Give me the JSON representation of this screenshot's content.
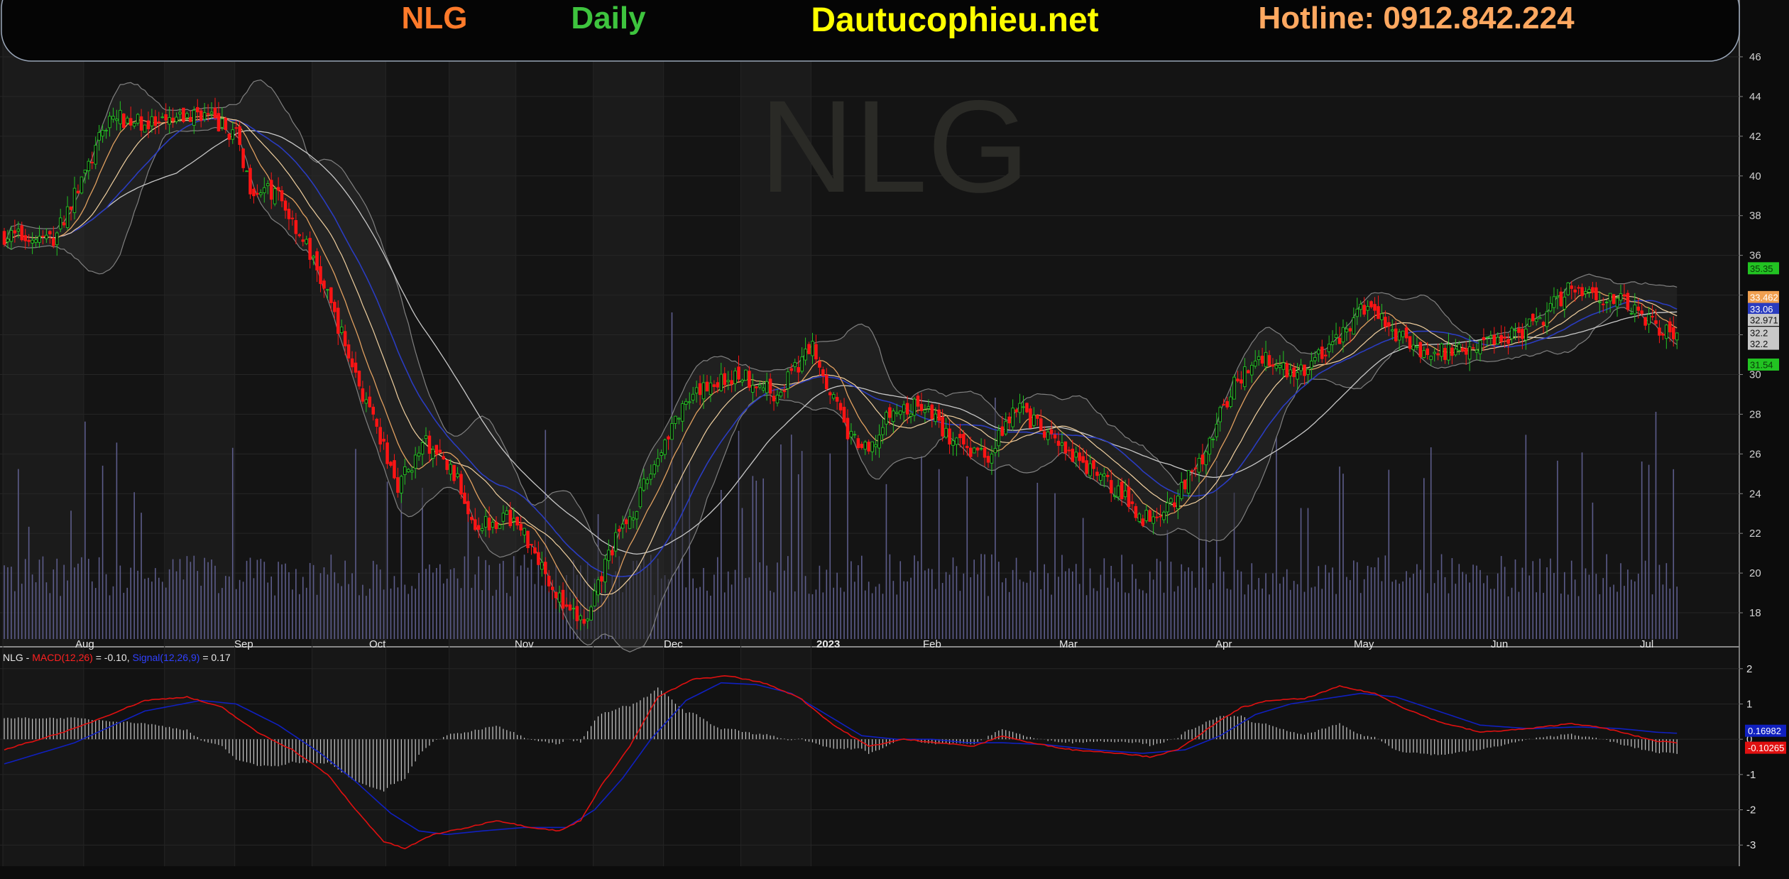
{
  "header": {
    "symbol": "NLG",
    "period": "Daily",
    "site": "Dautucophieu.net",
    "hotline": "Hotline: 0912.842.224"
  },
  "watermark": "NLG",
  "colors": {
    "background": "#151515",
    "up": "#22c322",
    "down": "#ff1414",
    "volume": "#5c5c8a",
    "sma_fast": "#e0a060",
    "sma_mid": "#f0d0a0",
    "sma_blue": "#2a3cc0",
    "sma_slow": "#c8c8c8",
    "band": "#808080",
    "macd": "#e01010",
    "signal": "#1020c0",
    "symbol_text": "#ff7a2a",
    "period_text": "#3ec43e",
    "site_text": "#ffff00",
    "hotline_text": "#ffa860"
  },
  "chart_data": [
    {
      "type": "candlestick",
      "title": "NLG",
      "x_months": [
        "Aug",
        "Sep",
        "Oct",
        "Nov",
        "Dec",
        "2023",
        "Feb",
        "Mar",
        "Apr",
        "May",
        "Jun",
        "Jul"
      ],
      "ylim": [
        16.5,
        46.5
      ],
      "y_ticks": [
        18,
        20,
        22,
        24,
        26,
        28,
        30,
        32,
        34,
        36,
        38,
        40,
        42,
        44,
        46
      ],
      "price_path": [
        [
          0,
          37.0
        ],
        [
          14,
          36.8
        ],
        [
          24,
          40.5
        ],
        [
          30,
          43.0
        ],
        [
          44,
          42.5
        ],
        [
          56,
          43.2
        ],
        [
          66,
          42.0
        ],
        [
          70,
          39.5
        ],
        [
          78,
          39.0
        ],
        [
          86,
          36.5
        ],
        [
          94,
          33.0
        ],
        [
          104,
          28.0
        ],
        [
          112,
          24.5
        ],
        [
          120,
          26.5
        ],
        [
          128,
          25.0
        ],
        [
          134,
          22.5
        ],
        [
          144,
          22.8
        ],
        [
          150,
          21.5
        ],
        [
          160,
          18.0
        ],
        [
          166,
          17.5
        ],
        [
          172,
          21.0
        ],
        [
          180,
          23.5
        ],
        [
          190,
          27.5
        ],
        [
          200,
          29.5
        ],
        [
          210,
          30.0
        ],
        [
          220,
          29.0
        ],
        [
          230,
          31.5
        ],
        [
          240,
          27.0
        ],
        [
          246,
          26.0
        ],
        [
          252,
          28.0
        ],
        [
          262,
          28.5
        ],
        [
          270,
          26.5
        ],
        [
          280,
          26.0
        ],
        [
          288,
          28.5
        ],
        [
          296,
          27.0
        ],
        [
          306,
          25.5
        ],
        [
          316,
          24.3
        ],
        [
          324,
          22.8
        ],
        [
          332,
          23.5
        ],
        [
          340,
          25.5
        ],
        [
          350,
          29.5
        ],
        [
          358,
          31.0
        ],
        [
          368,
          30.0
        ],
        [
          378,
          31.5
        ],
        [
          388,
          33.5
        ],
        [
          396,
          32.0
        ],
        [
          406,
          31.0
        ],
        [
          418,
          31.5
        ],
        [
          428,
          32.0
        ],
        [
          436,
          32.5
        ],
        [
          446,
          34.5
        ],
        [
          454,
          34.0
        ],
        [
          462,
          33.5
        ],
        [
          470,
          32.5
        ],
        [
          476,
          31.9
        ]
      ],
      "indicators": [
        "SMA 10",
        "SMA 20",
        "SMA 30",
        "SMA 50",
        "Bollinger Bands (20,2)"
      ],
      "price_labels": [
        {
          "value": "35.35",
          "price": 35.35,
          "color": "#22c322"
        },
        {
          "value": "33.462",
          "price": 33.9,
          "color": "#f0a050"
        },
        {
          "value": "33.06",
          "price": 33.3,
          "color": "#2a3cc0"
        },
        {
          "value": "32.971",
          "price": 32.75,
          "color": "#c8c8c8"
        },
        {
          "value": "32.2",
          "price": 32.1,
          "color": "#c8c8c8"
        },
        {
          "value": "32.2",
          "price": 31.55,
          "color": "#c8c8c8"
        },
        {
          "value": "31.54",
          "price": 30.5,
          "color": "#22c322"
        }
      ]
    },
    {
      "type": "line",
      "title": "NLG - MACD(12,26) = -0.10, Signal(12,26,9) = 0.17",
      "legend": {
        "prefix": "NLG - ",
        "macd_label": "MACD(12,26)",
        "macd_value": " = -0.10, ",
        "signal_label": "Signal(12,26,9)",
        "signal_value": " = 0.17"
      },
      "ylim": [
        -3.6,
        2.6
      ],
      "y_ticks": [
        2,
        1,
        0,
        -1,
        -2,
        -3
      ],
      "series": [
        {
          "name": "MACD(12,26)",
          "points": [
            [
              0,
              -0.3
            ],
            [
              20,
              0.3
            ],
            [
              40,
              1.1
            ],
            [
              52,
              1.2
            ],
            [
              62,
              0.9
            ],
            [
              72,
              0.2
            ],
            [
              82,
              -0.3
            ],
            [
              92,
              -1.0
            ],
            [
              100,
              -2.0
            ],
            [
              108,
              -2.9
            ],
            [
              114,
              -3.1
            ],
            [
              122,
              -2.7
            ],
            [
              132,
              -2.5
            ],
            [
              140,
              -2.3
            ],
            [
              150,
              -2.5
            ],
            [
              158,
              -2.6
            ],
            [
              164,
              -2.3
            ],
            [
              170,
              -1.3
            ],
            [
              178,
              -0.2
            ],
            [
              186,
              1.2
            ],
            [
              196,
              1.7
            ],
            [
              206,
              1.8
            ],
            [
              216,
              1.6
            ],
            [
              226,
              1.2
            ],
            [
              236,
              0.4
            ],
            [
              246,
              -0.2
            ],
            [
              256,
              0.0
            ],
            [
              266,
              -0.1
            ],
            [
              276,
              -0.2
            ],
            [
              284,
              0.1
            ],
            [
              292,
              -0.1
            ],
            [
              304,
              -0.3
            ],
            [
              318,
              -0.4
            ],
            [
              326,
              -0.5
            ],
            [
              334,
              -0.3
            ],
            [
              344,
              0.4
            ],
            [
              352,
              0.9
            ],
            [
              360,
              1.1
            ],
            [
              370,
              1.15
            ],
            [
              380,
              1.5
            ],
            [
              390,
              1.3
            ],
            [
              398,
              0.9
            ],
            [
              408,
              0.5
            ],
            [
              420,
              0.2
            ],
            [
              434,
              0.3
            ],
            [
              446,
              0.45
            ],
            [
              456,
              0.3
            ],
            [
              464,
              0.1
            ],
            [
              470,
              -0.05
            ],
            [
              476,
              -0.1
            ]
          ]
        },
        {
          "name": "Signal(12,26,9)",
          "points": [
            [
              0,
              -0.7
            ],
            [
              20,
              -0.1
            ],
            [
              40,
              0.8
            ],
            [
              56,
              1.1
            ],
            [
              66,
              1.0
            ],
            [
              78,
              0.4
            ],
            [
              90,
              -0.4
            ],
            [
              100,
              -1.2
            ],
            [
              110,
              -2.1
            ],
            [
              118,
              -2.6
            ],
            [
              126,
              -2.7
            ],
            [
              136,
              -2.6
            ],
            [
              148,
              -2.5
            ],
            [
              160,
              -2.5
            ],
            [
              168,
              -2.0
            ],
            [
              176,
              -1.1
            ],
            [
              184,
              0.0
            ],
            [
              194,
              1.1
            ],
            [
              204,
              1.6
            ],
            [
              214,
              1.55
            ],
            [
              224,
              1.3
            ],
            [
              234,
              0.7
            ],
            [
              244,
              0.1
            ],
            [
              254,
              0.0
            ],
            [
              264,
              0.0
            ],
            [
              274,
              -0.1
            ],
            [
              284,
              -0.1
            ],
            [
              296,
              -0.15
            ],
            [
              310,
              -0.3
            ],
            [
              324,
              -0.4
            ],
            [
              336,
              -0.3
            ],
            [
              346,
              0.1
            ],
            [
              356,
              0.7
            ],
            [
              366,
              1.0
            ],
            [
              376,
              1.15
            ],
            [
              386,
              1.3
            ],
            [
              396,
              1.2
            ],
            [
              408,
              0.8
            ],
            [
              420,
              0.4
            ],
            [
              434,
              0.3
            ],
            [
              448,
              0.35
            ],
            [
              460,
              0.3
            ],
            [
              470,
              0.2
            ],
            [
              476,
              0.17
            ]
          ]
        }
      ],
      "value_labels": [
        {
          "value": "0.16982",
          "y": 0.12,
          "color": "#1020c0"
        },
        {
          "value": "-0.10265",
          "y": -0.12,
          "color": "#e01010"
        }
      ]
    }
  ]
}
